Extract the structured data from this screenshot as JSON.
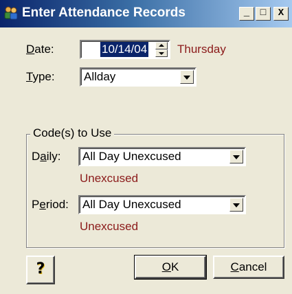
{
  "window": {
    "title": "Enter Attendance Records",
    "controls": {
      "minimize": "_",
      "maximize": "□",
      "close": "X"
    }
  },
  "date": {
    "label_key": "D",
    "label_rest": "ate:",
    "value": "10/14/04",
    "weekday": "Thursday"
  },
  "type": {
    "label_key": "T",
    "label_rest": "ype:",
    "value": "Allday"
  },
  "codes_group": {
    "legend": "Code(s) to Use",
    "daily": {
      "label_a": "D",
      "label_key": "a",
      "label_rest": "ily:",
      "value": "All Day Unexcused",
      "description": "Unexcused"
    },
    "period": {
      "label_a": "P",
      "label_key": "e",
      "label_rest": "riod:",
      "value": "All Day Unexcused",
      "description": "Unexcused"
    }
  },
  "buttons": {
    "help": "?",
    "ok_key": "O",
    "ok_rest": "K",
    "cancel_key": "C",
    "cancel_rest": "ancel"
  },
  "colors": {
    "titlebar_start": "#0a246a",
    "titlebar_end": "#a6caf0",
    "accent_text": "#8b1a1a",
    "dialog_bg": "#ece9d8"
  },
  "icons": {
    "app": "people-icon",
    "help": "question-mark-icon"
  }
}
